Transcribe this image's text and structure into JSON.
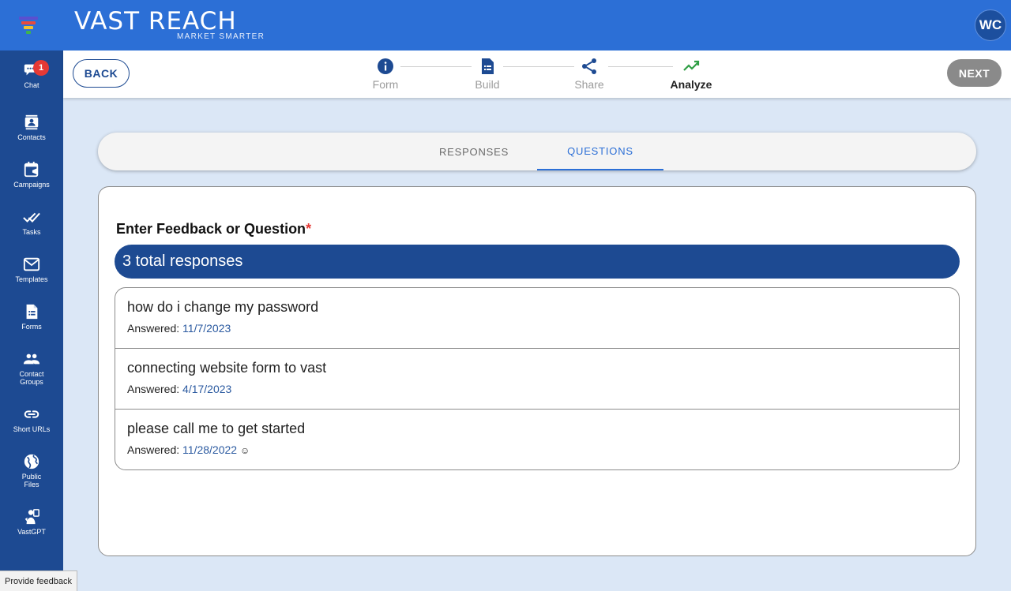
{
  "brand": {
    "name": "VAST REACH",
    "tagline": "MARKET SMARTER"
  },
  "user": {
    "initials": "WC"
  },
  "sidebar": {
    "items": [
      {
        "label": "Chat",
        "icon": "chat-icon",
        "badge": "1"
      },
      {
        "label": "Contacts",
        "icon": "contacts-icon"
      },
      {
        "label": "Campaigns",
        "icon": "campaigns-icon"
      },
      {
        "label": "Tasks",
        "icon": "tasks-icon"
      },
      {
        "label": "Templates",
        "icon": "mail-icon"
      },
      {
        "label": "Forms",
        "icon": "form-icon"
      },
      {
        "label": "Contact Groups",
        "icon": "group-icon"
      },
      {
        "label": "Short URLs",
        "icon": "link-icon"
      },
      {
        "label": "Public Files",
        "icon": "globe-icon"
      },
      {
        "label": "VastGPT",
        "icon": "gpt-icon"
      }
    ],
    "feedback_label": "Provide feedback"
  },
  "stepper": {
    "back_label": "BACK",
    "next_label": "NEXT",
    "steps": [
      {
        "label": "Form",
        "icon": "info-icon",
        "active": false
      },
      {
        "label": "Build",
        "icon": "document-icon",
        "active": false
      },
      {
        "label": "Share",
        "icon": "share-icon",
        "active": false
      },
      {
        "label": "Analyze",
        "icon": "trend-icon",
        "active": true
      }
    ]
  },
  "tabs": [
    {
      "label": "RESPONSES",
      "active": false
    },
    {
      "label": "QUESTIONS",
      "active": true
    }
  ],
  "question": {
    "title": "Enter Feedback or Question",
    "required_mark": "*",
    "total_responses": "3 total responses",
    "responses": [
      {
        "text": "how do i change my password",
        "answered_label": "Answered:",
        "date": "11/7/2023",
        "extra": ""
      },
      {
        "text": "connecting website form to vast",
        "answered_label": "Answered:",
        "date": "4/17/2023",
        "extra": ""
      },
      {
        "text": "please call me to get started",
        "answered_label": "Answered:",
        "date": "11/28/2022",
        "extra": "☺"
      }
    ]
  },
  "colors": {
    "topbar": "#2c6fd6",
    "sidebar": "#1d4a92",
    "accent": "#2c6fd6",
    "badge": "#e53935",
    "analyze_icon": "#2e9e44"
  }
}
